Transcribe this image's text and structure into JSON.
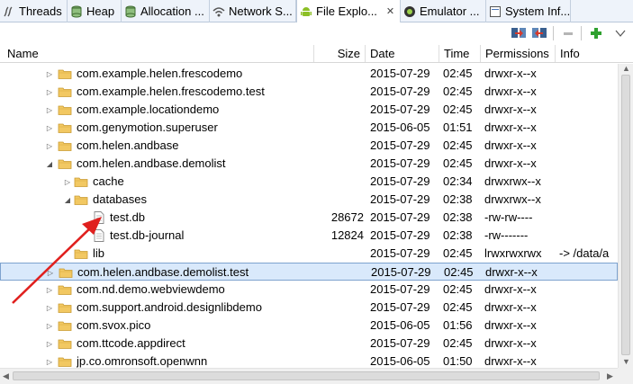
{
  "tabs": [
    {
      "label": "Threads",
      "icon": "threads-icon",
      "active": false
    },
    {
      "label": "Heap",
      "icon": "heap-icon",
      "active": false
    },
    {
      "label": "Allocation ...",
      "icon": "allocation-icon",
      "active": false
    },
    {
      "label": "Network S...",
      "icon": "network-icon",
      "active": false
    },
    {
      "label": "File Explo...",
      "icon": "android-icon",
      "active": true,
      "close": "✕"
    },
    {
      "label": "Emulator ...",
      "icon": "emulator-icon",
      "active": false
    },
    {
      "label": "System Inf...",
      "icon": "system-info-icon",
      "active": false
    }
  ],
  "toolbar": {
    "buttons": [
      "pull-file-icon",
      "push-file-icon",
      "delete-icon",
      "new-folder-icon"
    ],
    "menu_icon": "view-menu-chevron-icon"
  },
  "columns": {
    "name": "Name",
    "size": "Size",
    "date": "Date",
    "time": "Time",
    "permissions": "Permissions",
    "info": "Info"
  },
  "rows": [
    {
      "name": "com.example.helen.frescodemo",
      "size": "",
      "date": "2015-07-29",
      "time": "02:45",
      "perm": "drwxr-x--x",
      "info": "",
      "depth": 0,
      "type": "folder",
      "expander": "collapsed"
    },
    {
      "name": "com.example.helen.frescodemo.test",
      "size": "",
      "date": "2015-07-29",
      "time": "02:45",
      "perm": "drwxr-x--x",
      "info": "",
      "depth": 0,
      "type": "folder",
      "expander": "collapsed"
    },
    {
      "name": "com.example.locationdemo",
      "size": "",
      "date": "2015-07-29",
      "time": "02:45",
      "perm": "drwxr-x--x",
      "info": "",
      "depth": 0,
      "type": "folder",
      "expander": "collapsed"
    },
    {
      "name": "com.genymotion.superuser",
      "size": "",
      "date": "2015-06-05",
      "time": "01:51",
      "perm": "drwxr-x--x",
      "info": "",
      "depth": 0,
      "type": "folder",
      "expander": "collapsed"
    },
    {
      "name": "com.helen.andbase",
      "size": "",
      "date": "2015-07-29",
      "time": "02:45",
      "perm": "drwxr-x--x",
      "info": "",
      "depth": 0,
      "type": "folder",
      "expander": "collapsed"
    },
    {
      "name": "com.helen.andbase.demolist",
      "size": "",
      "date": "2015-07-29",
      "time": "02:45",
      "perm": "drwxr-x--x",
      "info": "",
      "depth": 0,
      "type": "folder",
      "expander": "expanded"
    },
    {
      "name": "cache",
      "size": "",
      "date": "2015-07-29",
      "time": "02:34",
      "perm": "drwxrwx--x",
      "info": "",
      "depth": 1,
      "type": "folder",
      "expander": "collapsed"
    },
    {
      "name": "databases",
      "size": "",
      "date": "2015-07-29",
      "time": "02:38",
      "perm": "drwxrwx--x",
      "info": "",
      "depth": 1,
      "type": "folder",
      "expander": "expanded"
    },
    {
      "name": "test.db",
      "size": "28672",
      "date": "2015-07-29",
      "time": "02:38",
      "perm": "-rw-rw----",
      "info": "",
      "depth": 2,
      "type": "file",
      "expander": "none"
    },
    {
      "name": "test.db-journal",
      "size": "12824",
      "date": "2015-07-29",
      "time": "02:38",
      "perm": "-rw-------",
      "info": "",
      "depth": 2,
      "type": "file",
      "expander": "none"
    },
    {
      "name": "lib",
      "size": "",
      "date": "2015-07-29",
      "time": "02:45",
      "perm": "lrwxrwxrwx",
      "info": "-> /data/a",
      "depth": 1,
      "type": "folder",
      "expander": "none"
    },
    {
      "name": "com.helen.andbase.demolist.test",
      "size": "",
      "date": "2015-07-29",
      "time": "02:45",
      "perm": "drwxr-x--x",
      "info": "",
      "depth": 0,
      "type": "folder",
      "expander": "collapsed",
      "selected": true
    },
    {
      "name": "com.nd.demo.webviewdemo",
      "size": "",
      "date": "2015-07-29",
      "time": "02:45",
      "perm": "drwxr-x--x",
      "info": "",
      "depth": 0,
      "type": "folder",
      "expander": "collapsed"
    },
    {
      "name": "com.support.android.designlibdemo",
      "size": "",
      "date": "2015-07-29",
      "time": "02:45",
      "perm": "drwxr-x--x",
      "info": "",
      "depth": 0,
      "type": "folder",
      "expander": "collapsed"
    },
    {
      "name": "com.svox.pico",
      "size": "",
      "date": "2015-06-05",
      "time": "01:56",
      "perm": "drwxr-x--x",
      "info": "",
      "depth": 0,
      "type": "folder",
      "expander": "collapsed"
    },
    {
      "name": "com.ttcode.appdirect",
      "size": "",
      "date": "2015-07-29",
      "time": "02:45",
      "perm": "drwxr-x--x",
      "info": "",
      "depth": 0,
      "type": "folder",
      "expander": "collapsed"
    },
    {
      "name": "jp.co.omronsoft.openwnn",
      "size": "",
      "date": "2015-06-05",
      "time": "01:50",
      "perm": "drwxr-x--x",
      "info": "",
      "depth": 0,
      "type": "folder",
      "expander": "collapsed"
    }
  ],
  "colors": {
    "selection_bg": "#d9e9fb",
    "selection_border": "#7da2ce",
    "folder": "#f2c862",
    "annotation_arrow": "#e0201e"
  }
}
